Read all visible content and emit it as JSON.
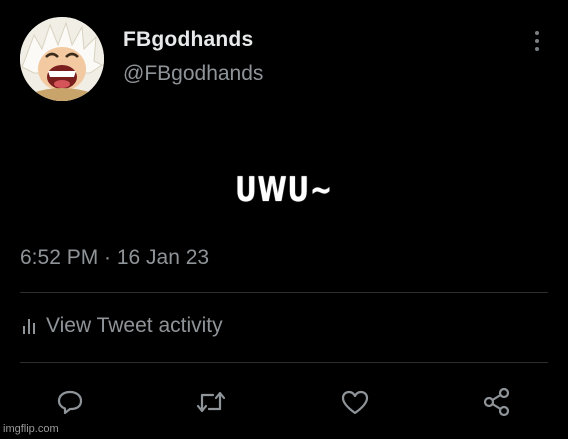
{
  "tweet": {
    "display_name": "FBgodhands",
    "handle": "@FBgodhands",
    "text": "UWU~",
    "timestamp": "6:52 PM · 16 Jan 23",
    "activity_label": "View Tweet activity"
  },
  "actions": [
    "reply-icon",
    "retweet-icon",
    "like-icon",
    "share-icon"
  ],
  "watermark": "imgflip.com",
  "colors": {
    "background": "#000000",
    "primary_text": "#e7e9ea",
    "secondary_text": "#8f9499",
    "divider": "#2a2e31"
  }
}
